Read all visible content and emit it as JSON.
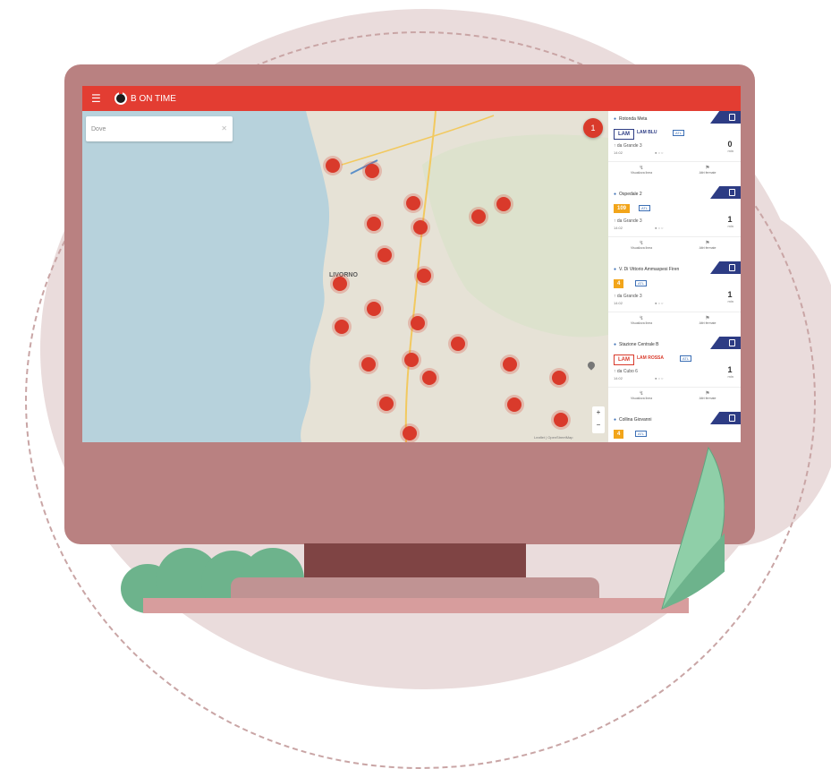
{
  "app": {
    "name": "B ON TIME",
    "menu_icon": "hamburger-icon"
  },
  "search": {
    "placeholder": "Dove"
  },
  "map": {
    "city_labels": [
      "LIVORNO"
    ],
    "fab_label": "1",
    "zoom": {
      "in": "+",
      "out": "−"
    },
    "attribution": "Leaflet | OpenStreetMap",
    "markers": [
      "",
      "",
      "",
      "",
      "",
      "",
      "",
      "",
      "",
      "",
      "",
      "",
      "",
      "",
      "",
      "",
      "",
      "",
      "",
      "",
      "",
      "",
      "",
      "",
      "",
      "",
      ""
    ]
  },
  "panel": {
    "cards": [
      {
        "title": "Rotonda Meta",
        "badge": "LAM",
        "badge_color": "#2d3c84",
        "line_label": "LAM BLU",
        "route": "↑ da Grande 3",
        "line_id": "14:02",
        "mins": "0",
        "unit": "min",
        "action1": "Visualizza linea",
        "action2": "Altri fermate"
      },
      {
        "title": "Ospedale 2",
        "badge": "109",
        "badge_color": "#f2a51a",
        "line_label": "",
        "route": "↑ da Grande 3",
        "line_id": "14:02",
        "mins": "1",
        "unit": "min",
        "action1": "Visualizza linea",
        "action2": "Altri fermate"
      },
      {
        "title": "V. Di Vittorio Ammaspesi Firen",
        "badge": "4",
        "badge_color": "#f2a51a",
        "line_label": "",
        "route": "↑ da Grande 3",
        "line_id": "14:02",
        "mins": "1",
        "unit": "min",
        "action1": "Visualizza linea",
        "action2": "Altri fermate"
      },
      {
        "title": "Stazione Centrale B",
        "badge": "LAM",
        "badge_color": "#d93a2b",
        "line_label": "LAM ROSSA",
        "route": "↑ da Cubo 6",
        "line_id": "14:02",
        "mins": "1",
        "unit": "min",
        "action1": "Visualizza linea",
        "action2": "Altri fermate"
      },
      {
        "title": "Collina Giovanni",
        "badge": "4",
        "badge_color": "#f2a51a",
        "line_label": "",
        "route": "",
        "line_id": "",
        "mins": "",
        "unit": "",
        "action1": "",
        "action2": ""
      }
    ]
  }
}
